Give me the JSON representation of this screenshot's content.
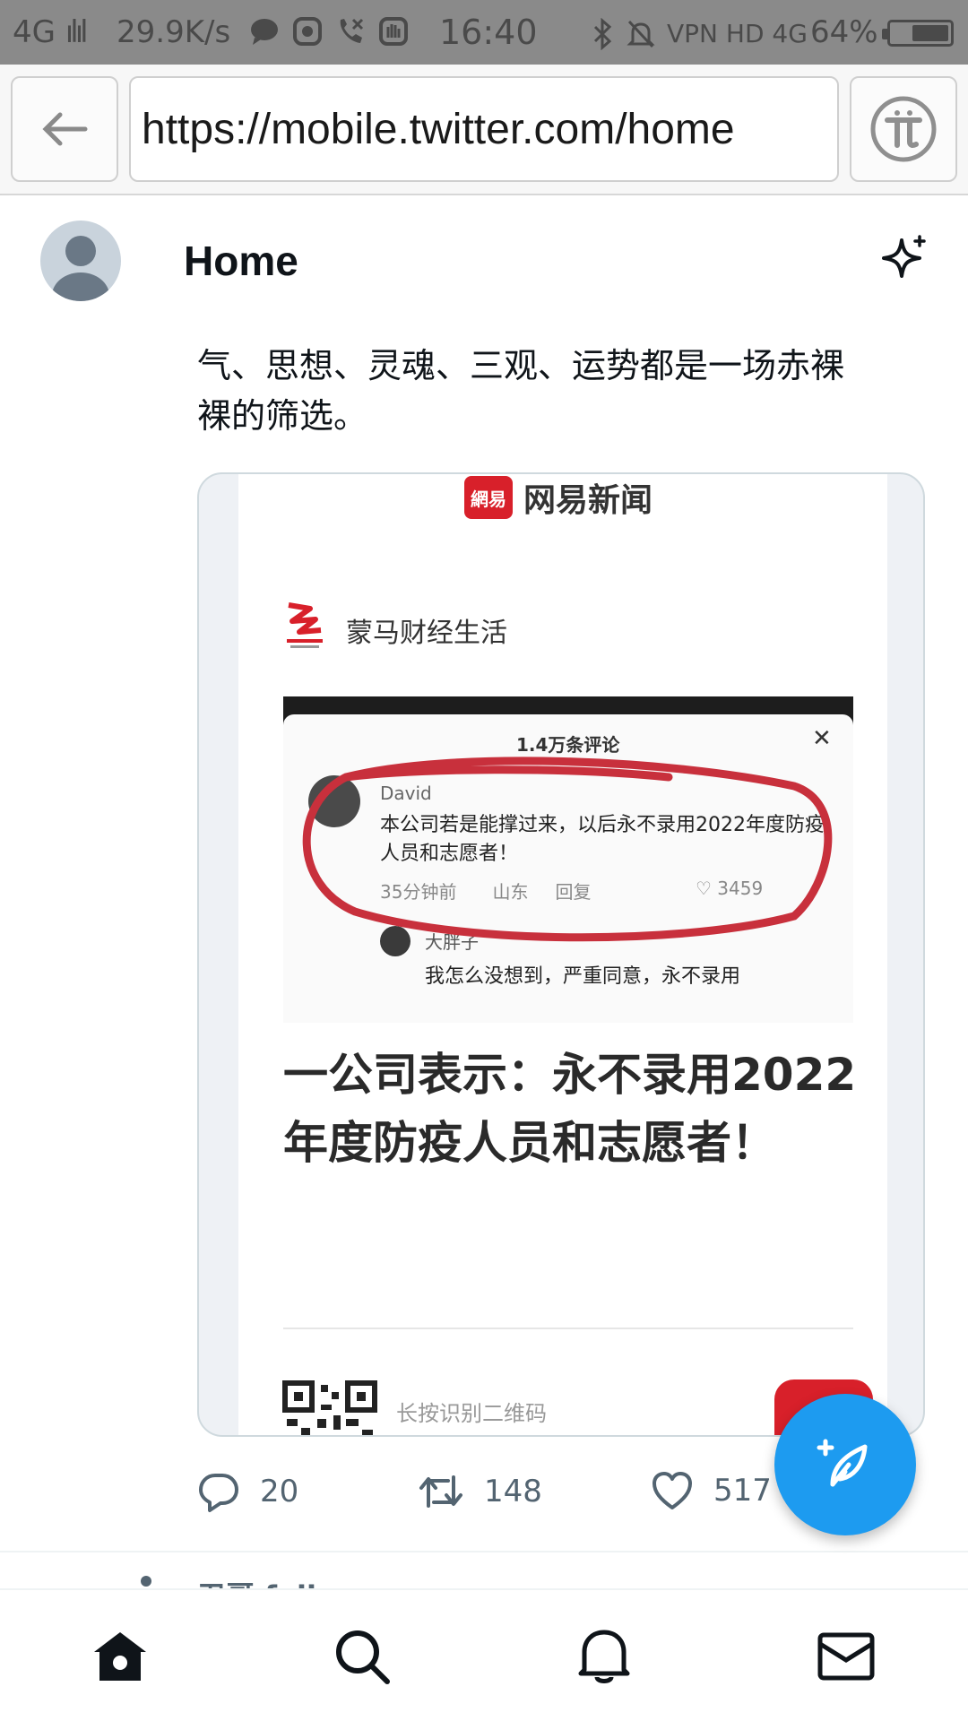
{
  "status_bar": {
    "signal": "4G",
    "speed": "29.9K/s",
    "time": "16:40",
    "network": "VPN HD 4G",
    "battery": "64%",
    "battery_level": 0.64
  },
  "browser": {
    "url": "https://mobile.twitter.com/home"
  },
  "header": {
    "title": "Home"
  },
  "tweet": {
    "text_line1": "气、思想、灵魂、三观、运势都是一场赤裸",
    "text_line2": "裸的筛选。",
    "media": {
      "news_app": "网易新闻",
      "news_logo_text": "網易",
      "source": "蒙马财经生活",
      "comment_count": "1.4万条评论",
      "comment1_user": "David",
      "comment1_text": "本公司若是能撑过来，以后永不录用2022年度防疫人员和志愿者！",
      "comment1_time": "35分钟前",
      "comment1_loc": "山东",
      "comment1_reply": "回复",
      "comment1_likes": "3459",
      "comment2_user": "大胖子",
      "comment2_text": "我怎么没想到，严重同意，永不录用",
      "headline": "一公司表示：永不录用2022年度防疫人员和志愿者！",
      "qr_text": "长按识别二维码"
    },
    "actions": {
      "replies": "20",
      "retweets": "148",
      "likes": "517"
    }
  },
  "next_tweet_peek": "卫哥 follows",
  "colors": {
    "twitter_blue": "#1d9bf0",
    "netease_red": "#d8202a",
    "highlight_red": "#c8303c"
  }
}
